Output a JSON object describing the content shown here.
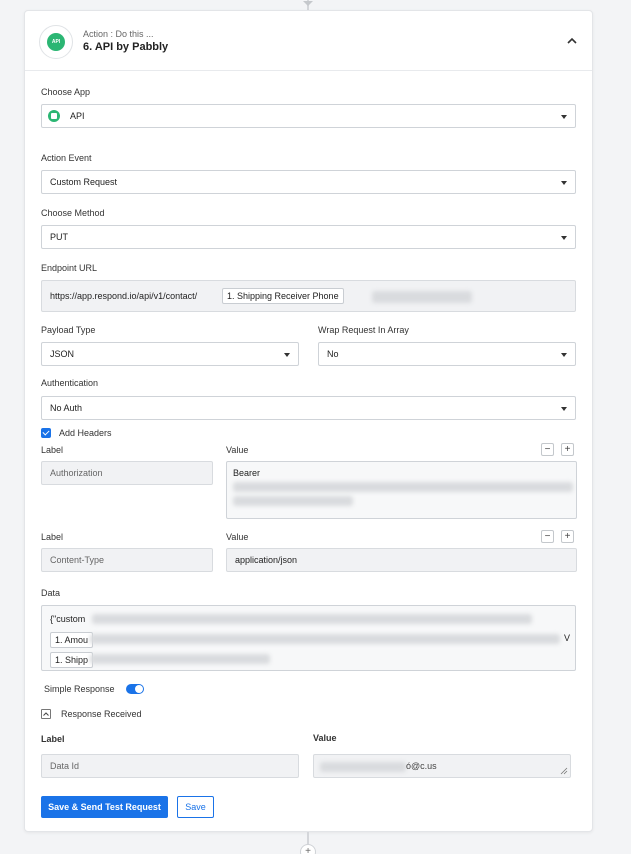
{
  "header": {
    "subtitle": "Action : Do this ...",
    "title": "6. API by Pabbly",
    "logo_text": "API"
  },
  "choose_app": {
    "label": "Choose App",
    "value": "API"
  },
  "action_event": {
    "label": "Action Event",
    "value": "Custom Request"
  },
  "choose_method": {
    "label": "Choose Method",
    "value": "PUT"
  },
  "endpoint": {
    "label": "Endpoint URL",
    "base": "https://app.respond.io/api/v1/contact/",
    "token": "1. Shipping Receiver Phone"
  },
  "payload_type": {
    "label": "Payload Type",
    "value": "JSON"
  },
  "wrap_request": {
    "label": "Wrap Request In Array",
    "value": "No"
  },
  "authentication": {
    "label": "Authentication",
    "value": "No Auth"
  },
  "add_headers": {
    "label": "Add Headers",
    "checked": true
  },
  "headers": [
    {
      "label_caption": "Label",
      "value_caption": "Value",
      "label": "Authorization",
      "value": "Bearer"
    },
    {
      "label_caption": "Label",
      "value_caption": "Value",
      "label": "Content-Type",
      "value": "application/json"
    }
  ],
  "header_buttons": {
    "minus": "−",
    "plus": "+"
  },
  "data": {
    "label": "Data",
    "line1": "{\"custom",
    "line2_token": "1. Amou",
    "line3_token": "1. Shipp",
    "trailing": "V"
  },
  "simple_response": {
    "label": "Simple Response",
    "enabled": true
  },
  "response_received": {
    "label": "Response Received"
  },
  "response_table": {
    "label_header": "Label",
    "value_header": "Value",
    "label": "Data Id",
    "value_visible": "ó@c.us"
  },
  "buttons": {
    "save_send": "Save & Send Test Request",
    "save": "Save"
  },
  "connector_plus": "+",
  "colors": {
    "primary": "#1a73e8",
    "api_green": "#2bb673"
  }
}
